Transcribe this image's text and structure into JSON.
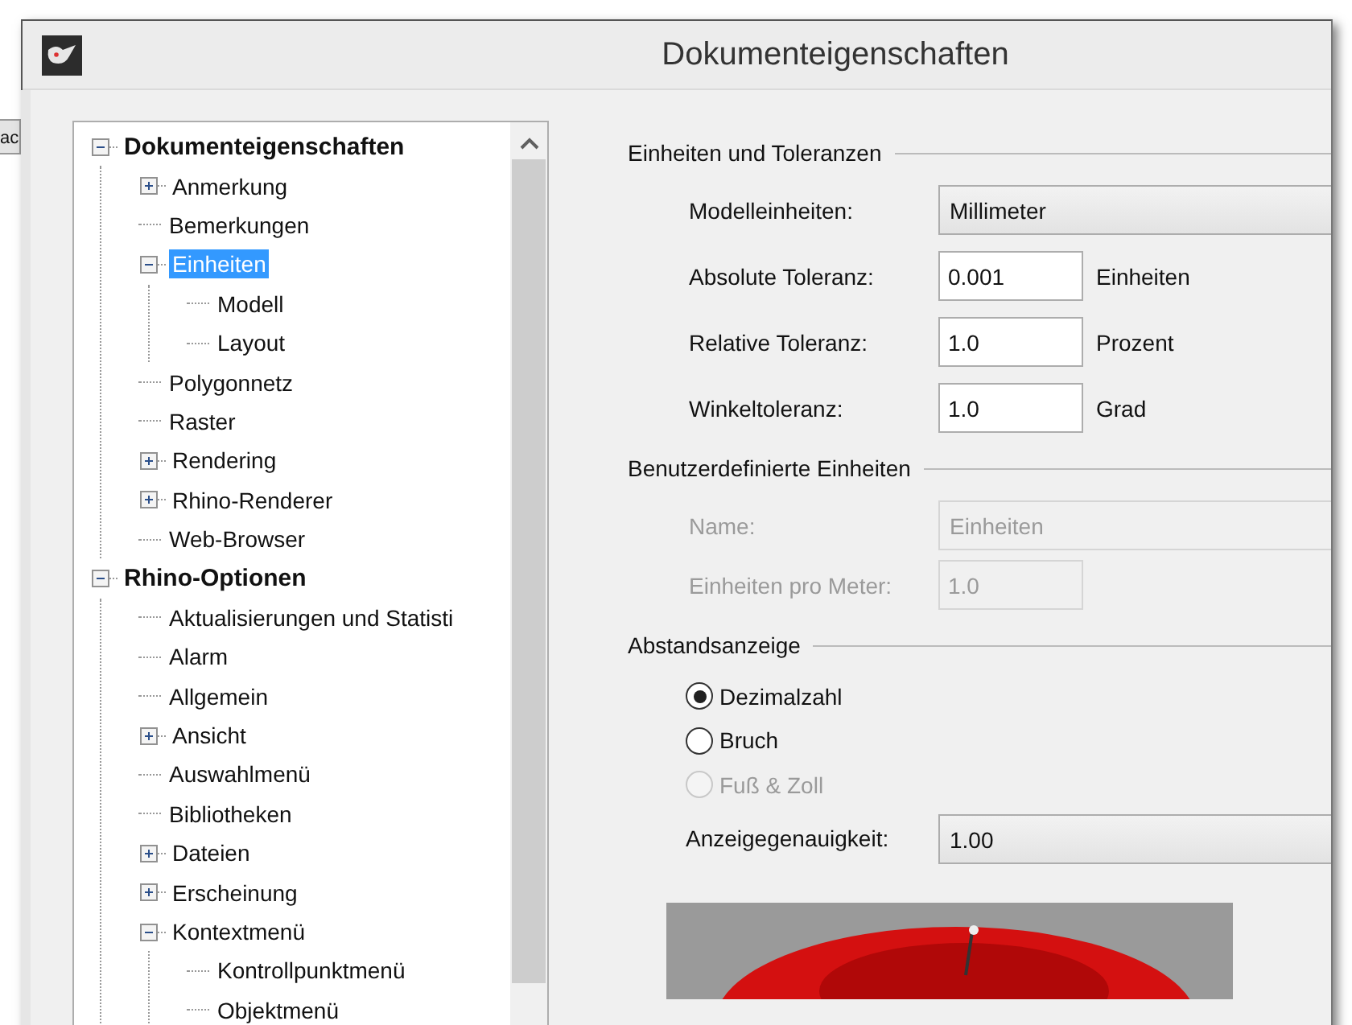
{
  "background_fragment": "ac",
  "window": {
    "title": "Dokumenteigenschaften"
  },
  "tree": {
    "items": [
      {
        "label": "Dokumenteigenschaften",
        "selected": false,
        "expanded": true,
        "children": [
          {
            "label": "Anmerkung",
            "selected": false,
            "expanded": false
          },
          {
            "label": "Bemerkungen",
            "selected": false
          },
          {
            "label": "Einheiten",
            "selected": true,
            "expanded": true,
            "children": [
              {
                "label": "Modell",
                "selected": false
              },
              {
                "label": "Layout",
                "selected": false
              }
            ]
          },
          {
            "label": "Polygonnetz",
            "selected": false
          },
          {
            "label": "Raster",
            "selected": false
          },
          {
            "label": "Rendering",
            "selected": false,
            "expanded": false
          },
          {
            "label": "Rhino-Renderer",
            "selected": false,
            "expanded": false
          },
          {
            "label": "Web-Browser",
            "selected": false
          }
        ]
      },
      {
        "label": "Rhino-Optionen",
        "selected": false,
        "expanded": true,
        "children": [
          {
            "label": "Aktualisierungen und Statisti",
            "selected": false
          },
          {
            "label": "Alarm",
            "selected": false
          },
          {
            "label": "Allgemein",
            "selected": false
          },
          {
            "label": "Ansicht",
            "selected": false,
            "expanded": false
          },
          {
            "label": "Auswahlmenü",
            "selected": false
          },
          {
            "label": "Bibliotheken",
            "selected": false
          },
          {
            "label": "Dateien",
            "selected": false,
            "expanded": false
          },
          {
            "label": "Erscheinung",
            "selected": false,
            "expanded": false
          },
          {
            "label": "Kontextmenü",
            "selected": false,
            "expanded": true,
            "children": [
              {
                "label": "Kontrollpunktmenü",
                "selected": false
              },
              {
                "label": "Objektmenü",
                "selected": false
              }
            ]
          }
        ]
      }
    ]
  },
  "units_section": {
    "title": "Einheiten und Toleranzen",
    "fields": [
      {
        "kind": "dropdown",
        "label": "Modelleinheiten:",
        "value": "Millimeter",
        "disabled": false
      },
      {
        "kind": "text",
        "label": "Absolute Toleranz:",
        "value": "0.001",
        "unit": "Einheiten",
        "disabled": false
      },
      {
        "kind": "text",
        "label": "Relative Toleranz:",
        "value": "1.0",
        "unit": "Prozent",
        "disabled": false
      },
      {
        "kind": "text",
        "label": "Winkeltoleranz:",
        "value": "1.0",
        "unit": "Grad",
        "disabled": false
      }
    ]
  },
  "custom_units": {
    "title": "Benutzerdefinierte Einheiten",
    "fields": [
      {
        "kind": "dropdown",
        "label": "Name:",
        "value": "Einheiten",
        "disabled": true
      },
      {
        "kind": "text",
        "label": "Einheiten pro Meter:",
        "value": "1.0",
        "disabled": true
      }
    ]
  },
  "distance_display": {
    "title": "Abstandsanzeige",
    "options": [
      {
        "label": "Dezimalzahl",
        "selected": true,
        "disabled": false
      },
      {
        "label": "Bruch",
        "selected": false,
        "disabled": false
      },
      {
        "label": "Fuß & Zoll",
        "selected": false,
        "disabled": true
      }
    ],
    "precision": {
      "label": "Anzeigegenauigkeit:",
      "value": "1.00"
    }
  }
}
